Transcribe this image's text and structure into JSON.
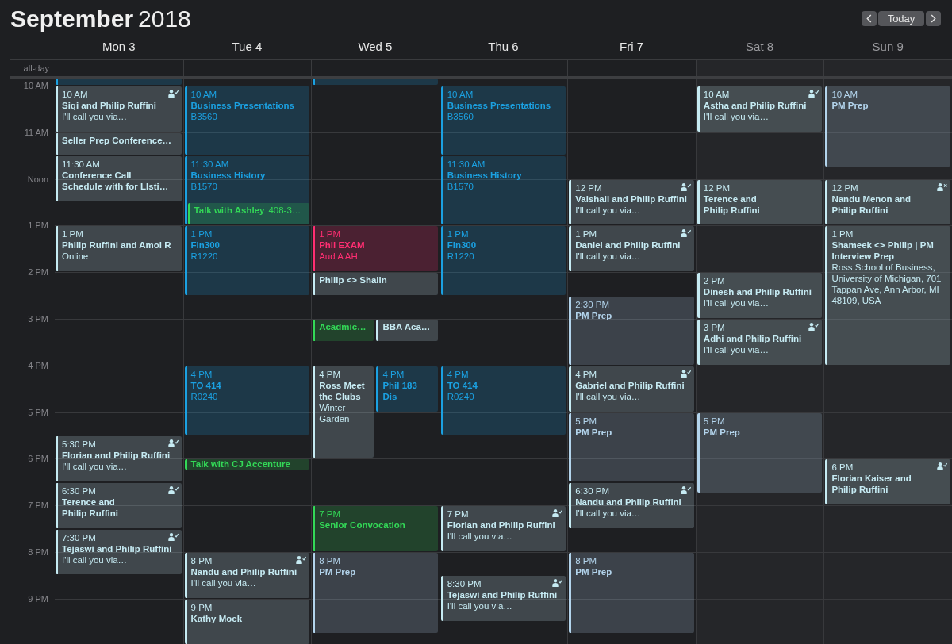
{
  "title": {
    "month": "September",
    "year": "2018"
  },
  "nav": {
    "today_button": "Today"
  },
  "all_day_label": "all-day",
  "hours": [
    "10 AM",
    "11 AM",
    "Noon",
    "1 PM",
    "2 PM",
    "3 PM",
    "4 PM",
    "5 PM",
    "6 PM",
    "7 PM",
    "8 PM",
    "9 PM"
  ],
  "days": [
    {
      "label": "Mon 3",
      "weekend": false,
      "events": [
        {
          "color": "#1ba1e2",
          "invitation": false
        },
        {
          "time": "10 AM",
          "title": "Siqi and Philip Ruffini",
          "detail": "I'll call you via…",
          "color": "#c6ebf3",
          "invitation": true,
          "declined": false
        },
        {
          "title": "Seller Prep Conference…",
          "color": "#c6ebf3",
          "invitation": false
        },
        {
          "time": "11:30 AM",
          "title": "Conference Call\nSchedule with for LIsti…",
          "color": "#c6ebf3",
          "invitation": false
        },
        {
          "time": "1 PM",
          "title": "Philip Ruffini and Amol R",
          "detail": "Online",
          "color": "#c6ebf3",
          "invitation": false
        },
        {
          "time": "5:30 PM",
          "title": "Florian and Philip Ruffini",
          "detail": "I'll call you via…",
          "color": "#c6ebf3",
          "invitation": true,
          "declined": false
        },
        {
          "time": "6:30 PM",
          "title": "Terence and\nPhilip Ruffini",
          "color": "#c6ebf3",
          "invitation": true,
          "declined": false
        },
        {
          "time": "7:30 PM",
          "title": "Tejaswi and Philip Ruffini",
          "detail": "I'll call you via…",
          "color": "#c6ebf3",
          "invitation": true,
          "declined": false
        }
      ]
    },
    {
      "label": "Tue 4",
      "weekend": false,
      "events": [
        {
          "time": "10 AM",
          "title": "Business Presentations",
          "detail": "B3560",
          "color": "#1ba1e2",
          "invitation": false
        },
        {
          "time": "11:30 AM",
          "title": "Business History",
          "detail": "B1570",
          "color": "#1ba1e2",
          "invitation": false
        },
        {
          "title": "Talk with Ashley",
          "detail": "408-3…",
          "color": "#33d957",
          "invitation": false
        },
        {
          "time": "1 PM",
          "title": "Fin300",
          "detail": "R1220",
          "color": "#1ba1e2",
          "invitation": false
        },
        {
          "time": "4 PM",
          "title": "TO 414",
          "detail": "R0240",
          "color": "#1ba1e2",
          "invitation": false
        },
        {
          "title": "Talk with CJ Accenture",
          "color": "#33d957",
          "invitation": false
        },
        {
          "time": "8 PM",
          "title": "Nandu and Philip Ruffini",
          "detail": "I'll call you via…",
          "color": "#c6ebf3",
          "invitation": true,
          "declined": false
        },
        {
          "time": "9 PM",
          "title": "Kathy Mock",
          "color": "#c6ebf3",
          "invitation": false
        }
      ]
    },
    {
      "label": "Wed 5",
      "weekend": false,
      "events": [
        {
          "color": "#1ba1e2",
          "invitation": false
        },
        {
          "time": "1 PM",
          "title": "Phil EXAM",
          "detail": "Aud A AH",
          "color": "#ff2e72",
          "invitation": false
        },
        {
          "title": "Philip <> Shalin",
          "color": "#c6ebf3",
          "invitation": false
        },
        {
          "title": "Acadmic…",
          "color": "#33d957",
          "invitation": false
        },
        {
          "title": "BBA Aca…",
          "color": "#c6ebf3",
          "invitation": false
        },
        {
          "time": "4 PM",
          "title": "Ross Meet\nthe Clubs",
          "detail": "Winter\nGarden",
          "color": "#c6ebf3",
          "invitation": false
        },
        {
          "time": "4 PM",
          "title": "Phil 183\nDis",
          "color": "#1ba1e2",
          "invitation": false
        },
        {
          "time": "7 PM",
          "title": "Senior Convocation",
          "color": "#33d957",
          "invitation": false
        },
        {
          "time": "8 PM",
          "title": "PM Prep",
          "color": "#b3d4ec",
          "invitation": false
        }
      ]
    },
    {
      "label": "Thu 6",
      "weekend": false,
      "events": [
        {
          "time": "10 AM",
          "title": "Business Presentations",
          "detail": "B3560",
          "color": "#1ba1e2",
          "invitation": false
        },
        {
          "time": "11:30 AM",
          "title": "Business History",
          "detail": "B1570",
          "color": "#1ba1e2",
          "invitation": false
        },
        {
          "time": "1 PM",
          "title": "Fin300",
          "detail": "R1220",
          "color": "#1ba1e2",
          "invitation": false
        },
        {
          "time": "4 PM",
          "title": "TO 414",
          "detail": "R0240",
          "color": "#1ba1e2",
          "invitation": false
        },
        {
          "time": "7 PM",
          "title": "Florian and Philip Ruffini",
          "detail": "I'll call you via…",
          "color": "#c6ebf3",
          "invitation": true,
          "declined": false
        },
        {
          "time": "8:30 PM",
          "title": "Tejaswi and Philip Ruffini",
          "detail": "I'll call you via…",
          "color": "#c6ebf3",
          "invitation": true,
          "declined": false
        }
      ]
    },
    {
      "label": "Fri 7",
      "weekend": false,
      "events": [
        {
          "time": "12 PM",
          "title": "Vaishali and Philip Ruffini",
          "detail": "I'll call you via…",
          "color": "#c6ebf3",
          "invitation": true,
          "declined": false
        },
        {
          "time": "1 PM",
          "title": "Daniel and Philip Ruffini",
          "detail": "I'll call you via…",
          "color": "#c6ebf3",
          "invitation": true,
          "declined": false
        },
        {
          "time": "2:30 PM",
          "title": "PM Prep",
          "color": "#b3d4ec",
          "invitation": false
        },
        {
          "time": "4 PM",
          "title": "Gabriel and Philip Ruffini",
          "detail": "I'll call you via…",
          "color": "#c6ebf3",
          "invitation": true,
          "declined": false
        },
        {
          "time": "5 PM",
          "title": "PM Prep",
          "color": "#b3d4ec",
          "invitation": false
        },
        {
          "time": "6:30 PM",
          "title": "Nandu and Philip Ruffini",
          "detail": "I'll call you via…",
          "color": "#c6ebf3",
          "invitation": true,
          "declined": false
        },
        {
          "time": "8 PM",
          "title": "PM Prep",
          "color": "#b3d4ec",
          "invitation": false
        }
      ]
    },
    {
      "label": "Sat 8",
      "weekend": true,
      "events": [
        {
          "time": "10 AM",
          "title": "Astha and Philip Ruffini",
          "detail": "I'll call you via…",
          "color": "#c6ebf3",
          "invitation": true,
          "declined": false
        },
        {
          "time": "12 PM",
          "title": "Terence and\nPhilip Ruffini",
          "color": "#c6ebf3",
          "invitation": false
        },
        {
          "time": "2 PM",
          "title": "Dinesh and Philip Ruffini",
          "detail": "I'll call you via…",
          "color": "#c6ebf3",
          "invitation": false
        },
        {
          "time": "3 PM",
          "title": "Adhi and Philip Ruffini",
          "detail": "I'll call you via…",
          "color": "#c6ebf3",
          "invitation": true,
          "declined": false
        },
        {
          "time": "5 PM",
          "title": "PM Prep",
          "color": "#b3d4ec",
          "invitation": false
        }
      ]
    },
    {
      "label": "Sun 9",
      "weekend": true,
      "events": [
        {
          "time": "10 AM",
          "title": "PM Prep",
          "color": "#b3d4ec",
          "invitation": false
        },
        {
          "time": "12 PM",
          "title": "Nandu Menon and\nPhilip Ruffini",
          "color": "#c6ebf3",
          "invitation": true,
          "declined": true
        },
        {
          "time": "1 PM",
          "title": "Shameek <> Philip | PM\nInterview Prep",
          "detail": "Ross School of Business,\nUniversity of Michigan, 701\nTappan Ave, Ann Arbor, MI\n48109, USA",
          "color": "#c6ebf3",
          "invitation": false
        },
        {
          "time": "6 PM",
          "title": "Florian Kaiser and\nPhilip Ruffini",
          "color": "#c6ebf3",
          "invitation": true,
          "declined": false
        }
      ]
    }
  ]
}
